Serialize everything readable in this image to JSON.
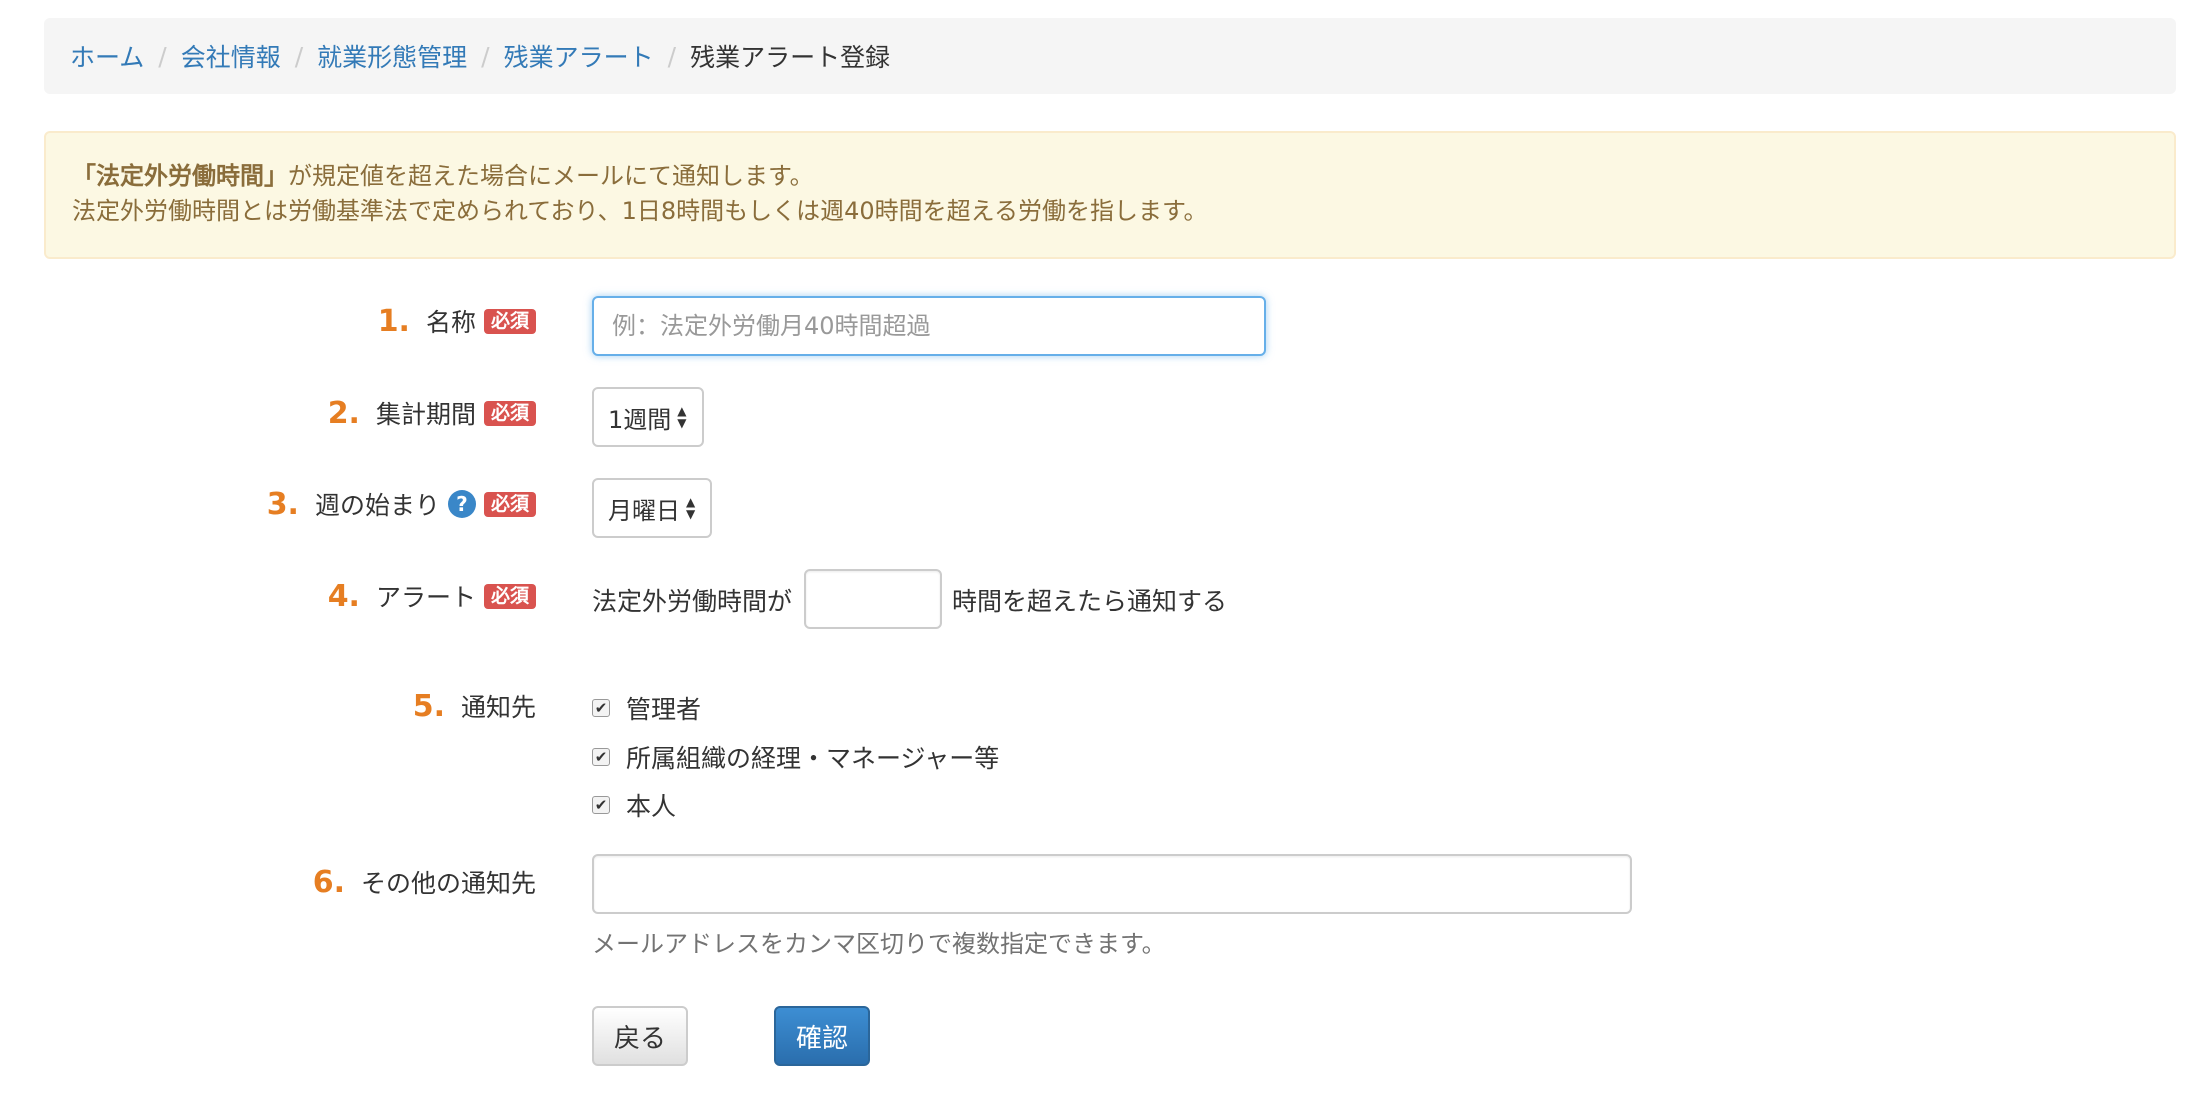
{
  "breadcrumb": {
    "items": [
      "ホーム",
      "会社情報",
      "就業形態管理",
      "残業アラート"
    ],
    "current": "残業アラート登録",
    "separator": "/"
  },
  "alert": {
    "bold": "「法定外労働時間」",
    "line1_rest": "が規定値を超えた場合にメールにて通知します。",
    "line2": "法定外労働時間とは労働基準法で定められており、1日8時間もしくは週40時間を超える労働を指します。"
  },
  "required_badge": "必須",
  "form": {
    "name": {
      "num": "1.",
      "label": "名称",
      "placeholder": "例：法定外労働月40時間超過",
      "value": ""
    },
    "period": {
      "num": "2.",
      "label": "集計期間",
      "selected": "1週間"
    },
    "week_start": {
      "num": "3.",
      "label": "週の始まり",
      "help": "?",
      "selected": "月曜日"
    },
    "alert": {
      "num": "4.",
      "label": "アラート",
      "prefix": "法定外労働時間が",
      "value": "",
      "suffix": "時間を超えたら通知する"
    },
    "recipients": {
      "num": "5.",
      "label": "通知先",
      "options": [
        {
          "label": "管理者",
          "checked": true
        },
        {
          "label": "所属組織の経理・マネージャー等",
          "checked": true
        },
        {
          "label": "本人",
          "checked": true
        }
      ]
    },
    "other": {
      "num": "6.",
      "label": "その他の通知先",
      "value": "",
      "help": "メールアドレスをカンマ区切りで複数指定できます。"
    }
  },
  "buttons": {
    "back": "戻る",
    "confirm": "確認"
  },
  "colors": {
    "link": "#337ab7",
    "number": "#e67e22",
    "required": "#d9534f",
    "primary": "#337ab7"
  }
}
